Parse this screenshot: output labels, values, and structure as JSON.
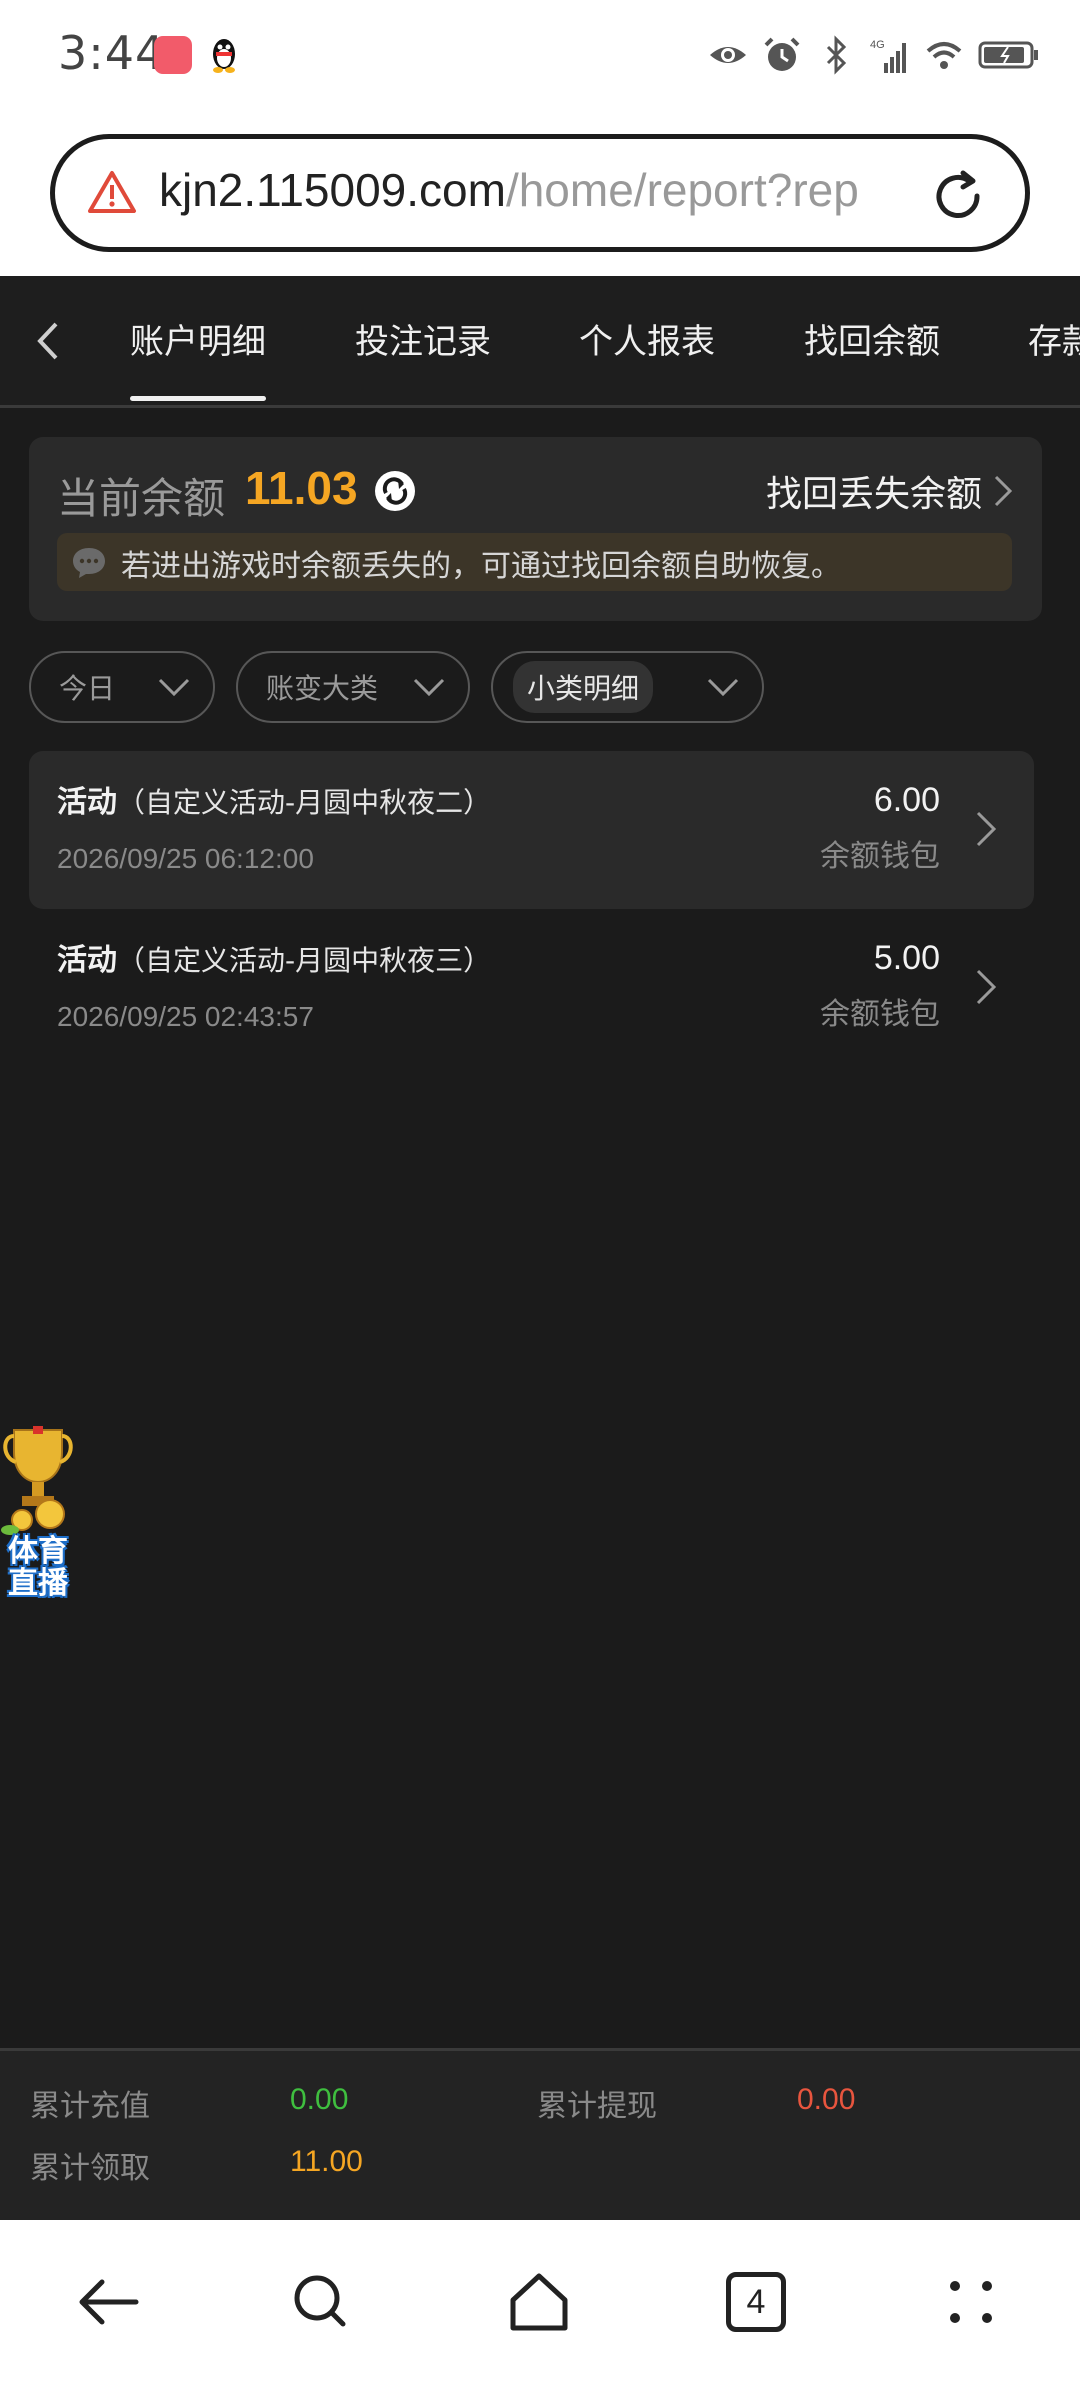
{
  "status_bar": {
    "time": "3:44",
    "icons": [
      "shopping-bag-app-icon",
      "qq-penguin-icon",
      "eye-icon",
      "alarm-icon",
      "bluetooth-icon",
      "4g-signal-icon",
      "wifi-icon",
      "battery-icon"
    ]
  },
  "browser": {
    "url_host": "kjn2.115009.com",
    "url_path": "/home/report?rep",
    "security_icon": "warning-triangle-icon",
    "reload_icon": "reload-icon"
  },
  "tabs": [
    {
      "label": "账户明细",
      "active": true
    },
    {
      "label": "投注记录",
      "active": false
    },
    {
      "label": "个人报表",
      "active": false
    },
    {
      "label": "找回余额",
      "active": false
    },
    {
      "label": "存款",
      "active": false
    }
  ],
  "balance": {
    "label": "当前余额",
    "value": "11.03",
    "recover_label": "找回丢失余额",
    "notice": "若进出游戏时余额丢失的，可通过找回余额自助恢复。"
  },
  "filters": [
    {
      "label": "今日"
    },
    {
      "label": "账变大类"
    },
    {
      "label": "小类明细"
    }
  ],
  "records": [
    {
      "type": "活动",
      "detail": "（自定义活动-月圆中秋夜二）",
      "time": "2026/09/25 06:12:00",
      "amount": "6.00",
      "wallet": "余额钱包"
    },
    {
      "type": "活动",
      "detail": "（自定义活动-月圆中秋夜三）",
      "time": "2026/09/25 02:43:57",
      "amount": "5.00",
      "wallet": "余额钱包"
    }
  ],
  "float_widget": {
    "line1": "体育",
    "line2": "直播"
  },
  "summary": {
    "deposit_label": "累计充值",
    "deposit_value": "0.00",
    "withdraw_label": "累计提现",
    "withdraw_value": "0.00",
    "claim_label": "累计领取",
    "claim_value": "11.00"
  },
  "bottom_nav": {
    "tabs_count": "4"
  },
  "colors": {
    "accent": "#f5a623",
    "deposit": "#3fbf3f",
    "withdraw": "#e8553e",
    "bg": "#1b1b1b"
  }
}
